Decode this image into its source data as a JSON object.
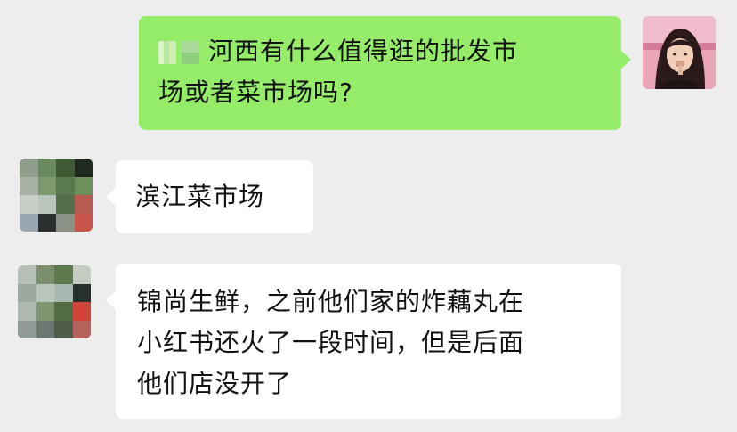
{
  "chat": {
    "messages": [
      {
        "sender": "self",
        "lines": [
          "河西有什么值得逛的批发市",
          "场或者菜市场吗?"
        ]
      },
      {
        "sender": "other",
        "lines": [
          "滨江菜市场"
        ]
      },
      {
        "sender": "other",
        "lines": [
          "锦尚生鲜，之前他们家的炸藕丸在",
          "小红书还火了一段时间，但是后面",
          "他们店没开了"
        ]
      }
    ]
  },
  "colors": {
    "background": "#ededed",
    "self_bubble": "#95ec69",
    "other_bubble": "#ffffff",
    "text": "#111111"
  }
}
